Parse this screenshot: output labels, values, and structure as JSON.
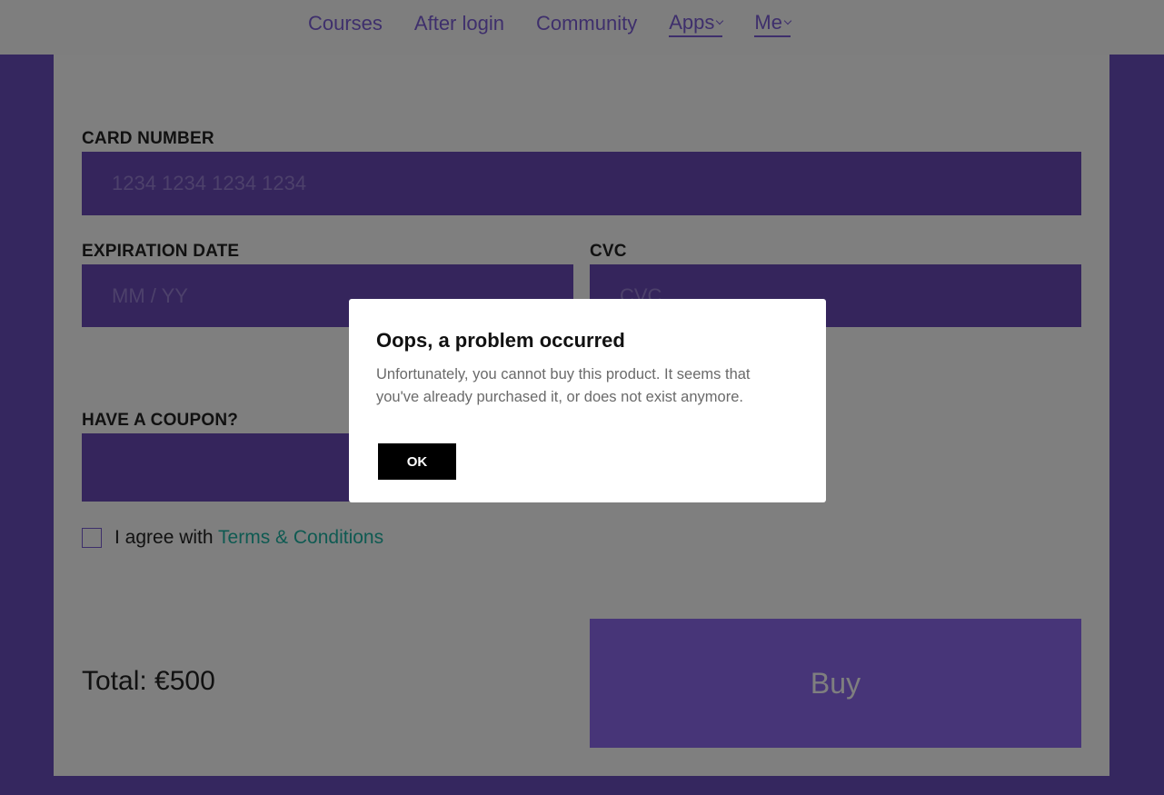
{
  "nav": {
    "items": [
      {
        "label": "Courses"
      },
      {
        "label": "After login"
      },
      {
        "label": "Community"
      },
      {
        "label": "Apps"
      },
      {
        "label": "Me"
      }
    ]
  },
  "form": {
    "card_number": {
      "label": "CARD NUMBER",
      "placeholder": "1234 1234 1234 1234",
      "value": ""
    },
    "expiration": {
      "label": "EXPIRATION DATE",
      "placeholder": "MM / YY",
      "value": ""
    },
    "cvc": {
      "label": "CVC",
      "placeholder": "CVC",
      "value": ""
    },
    "coupon": {
      "label": "HAVE A COUPON?",
      "value": ""
    },
    "agree_text": "I agree with",
    "terms_link": "Terms & Conditions",
    "total": "Total: €500",
    "buy_label": "Buy"
  },
  "modal": {
    "title": "Oops, a problem occurred",
    "message": "Unfortunately, you cannot buy this product. It seems that you've already purchased it, or does not exist anymore.",
    "ok_label": "OK"
  },
  "colors": {
    "accent": "#7d5ed8",
    "input_fill": "#6a4bb8",
    "buy_button": "#8e6bf0",
    "link_teal": "#1fb5a4",
    "overlay": "rgba(0,0,0,0.5)"
  },
  "icons": {
    "apps_menu": "chevron-down-icon",
    "me_menu": "chevron-down-icon"
  }
}
